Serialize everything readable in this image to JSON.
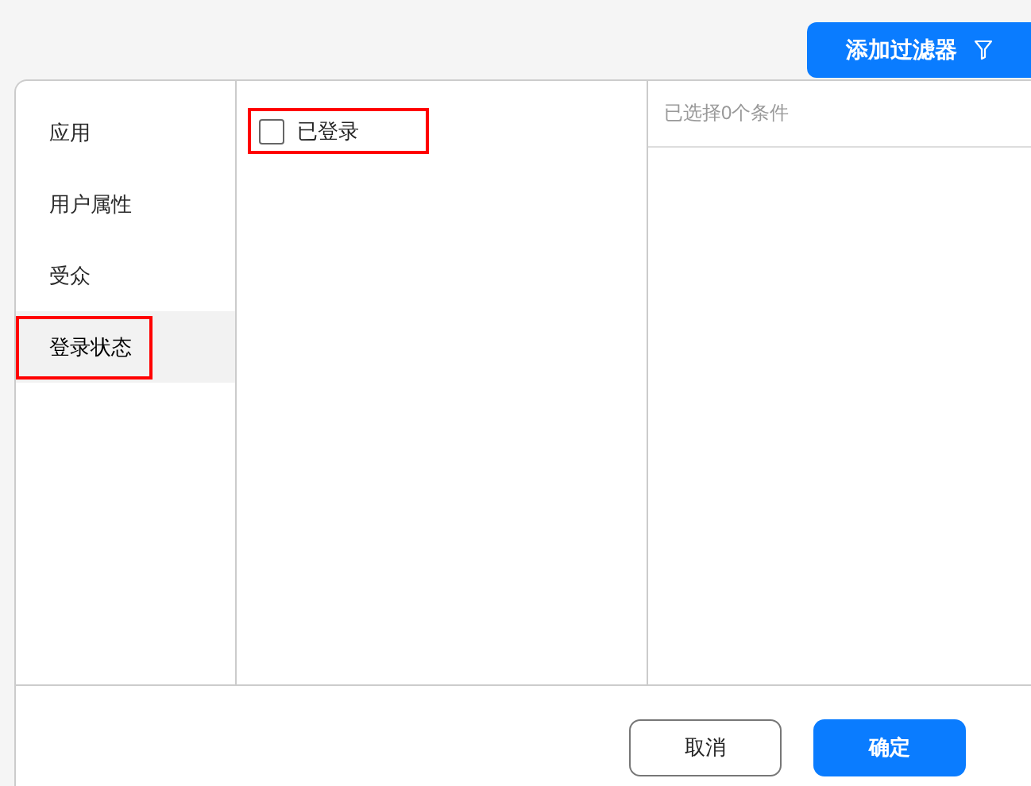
{
  "add_filter_button": {
    "label": "添加过滤器"
  },
  "categories": [
    {
      "label": "应用",
      "selected": false,
      "highlighted": false
    },
    {
      "label": "用户属性",
      "selected": false,
      "highlighted": false
    },
    {
      "label": "受众",
      "selected": false,
      "highlighted": false
    },
    {
      "label": "登录状态",
      "selected": true,
      "highlighted": true
    }
  ],
  "options": [
    {
      "label": "已登录",
      "checked": false,
      "highlighted": true
    }
  ],
  "selected_summary": "已选择0个条件",
  "footer_buttons": [
    {
      "label": "取消",
      "kind": "secondary"
    },
    {
      "label": "确定",
      "kind": "primary"
    }
  ]
}
